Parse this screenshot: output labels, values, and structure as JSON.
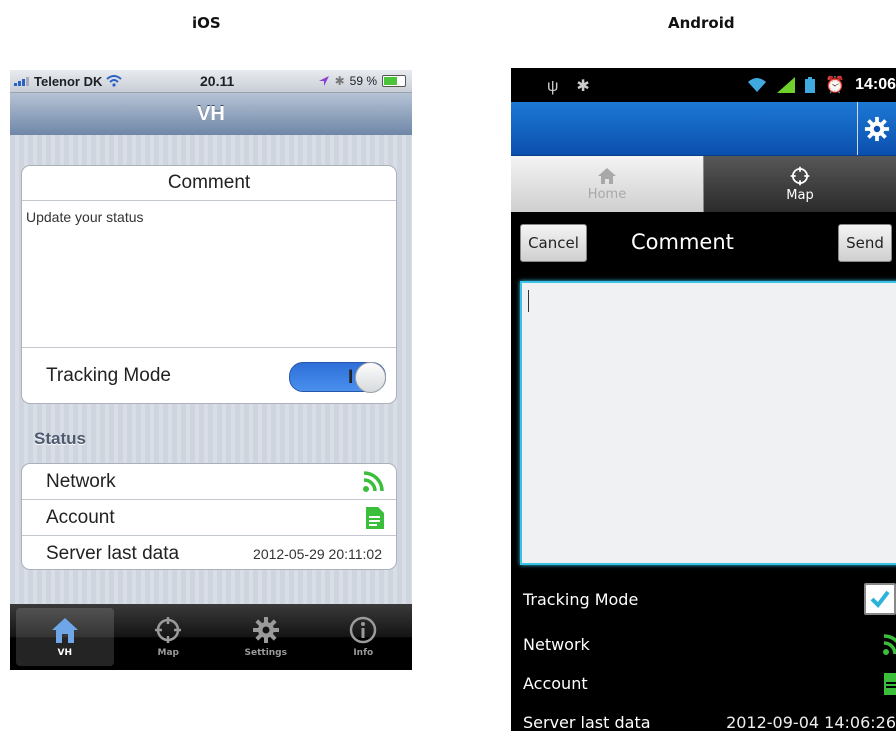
{
  "headings": {
    "ios": "iOS",
    "android": "Android"
  },
  "ios": {
    "status_bar": {
      "carrier": "Telenor DK",
      "time": "20.11",
      "battery": "59 %"
    },
    "nav_title": "VH",
    "comment": {
      "header": "Comment",
      "placeholder": "Update your status"
    },
    "tracking_mode": {
      "label": "Tracking Mode",
      "switch_text": "I",
      "on": true
    },
    "status_section": "Status",
    "rows": {
      "network": "Network",
      "account": "Account",
      "server_label": "Server last data",
      "server_value": "2012-05-29 20:11:02"
    },
    "tabs": {
      "vh": "VH",
      "map": "Map",
      "settings": "Settings",
      "info": "Info"
    },
    "colors": {
      "switch_blue": "#2d6fd8",
      "icon_green": "#3bbf3b",
      "nav": "#6f87a8"
    }
  },
  "android": {
    "status_bar": {
      "time": "14:06"
    },
    "tabs": {
      "home": "Home",
      "map": "Map"
    },
    "actions": {
      "cancel": "Cancel",
      "title": "Comment",
      "send": "Send"
    },
    "rows": {
      "tracking": "Tracking Mode",
      "network": "Network",
      "account": "Account",
      "server_label": "Server last data",
      "server_value": "2012-09-04 14:06:26"
    },
    "colors": {
      "action_bar": "#0b4fae",
      "text_border": "#39c3e6",
      "icon_green": "#3bbf3b"
    }
  }
}
